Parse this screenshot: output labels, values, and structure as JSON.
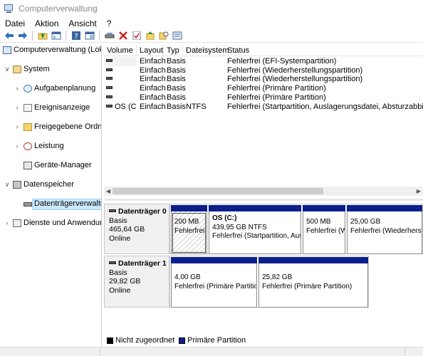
{
  "window": {
    "title": "Computerverwaltung"
  },
  "menu": {
    "items": [
      "Datei",
      "Aktion",
      "Ansicht",
      "?"
    ]
  },
  "toolbar": {
    "buttons": [
      "back-arrow-icon",
      "forward-arrow-icon",
      "up-folder-icon",
      "show-hide-tree-icon",
      "help-icon",
      "properties-icon",
      "connect-drive-icon",
      "delete-icon",
      "check-icon",
      "export-icon",
      "search-icon",
      "rescan-icon"
    ]
  },
  "tree": {
    "root": "Computerverwaltung (Lokal)",
    "system": "System",
    "aufgabenplanung": "Aufgabenplanung",
    "ereignisanzeige": "Ereignisanzeige",
    "freigaben": "Freigegebene Ordner",
    "leistung": "Leistung",
    "geraete": "Geräte-Manager",
    "datenspeicher": "Datenspeicher",
    "datentraeger": "Datenträgerverwaltung",
    "dienste": "Dienste und Anwendungen"
  },
  "volumes": {
    "headers": [
      "Volume",
      "Layout",
      "Typ",
      "Dateisystem",
      "Status"
    ],
    "rows": [
      [
        "",
        "Einfach",
        "Basis",
        "",
        "Fehlerfrei (EFI-Systempartition)"
      ],
      [
        "",
        "Einfach",
        "Basis",
        "",
        "Fehlerfrei (Wiederherstellungspartition)"
      ],
      [
        "",
        "Einfach",
        "Basis",
        "",
        "Fehlerfrei (Wiederherstellungspartition)"
      ],
      [
        "",
        "Einfach",
        "Basis",
        "",
        "Fehlerfrei (Primäre Partition)"
      ],
      [
        "",
        "Einfach",
        "Basis",
        "",
        "Fehlerfrei (Primäre Partition)"
      ],
      [
        "OS (C:)",
        "Einfach",
        "Basis",
        "NTFS",
        "Fehlerfrei (Startpartition, Auslagerungsdatei, Absturzabbild, Primäre P"
      ]
    ]
  },
  "disks": [
    {
      "name": "Datenträger 0",
      "type": "Basis",
      "size": "465,64 GB",
      "state": "Online",
      "partitions": [
        {
          "title": "",
          "size": "200 MB",
          "status": "Fehlerfrei ("
        },
        {
          "title": "OS  (C:)",
          "size": "439,95 GB NTFS",
          "status": "Fehlerfrei (Startpartition, Ausla"
        },
        {
          "title": "",
          "size": "500 MB",
          "status": "Fehlerfrei (W"
        },
        {
          "title": "",
          "size": "25,00 GB",
          "status": "Fehlerfrei (Wiederherste"
        }
      ]
    },
    {
      "name": "Datenträger 1",
      "type": "Basis",
      "size": "29,82 GB",
      "state": "Online",
      "partitions": [
        {
          "title": "",
          "size": "4,00 GB",
          "status": "Fehlerfrei (Primäre Partition)"
        },
        {
          "title": "",
          "size": "25,82 GB",
          "status": "Fehlerfrei (Primäre Partition)"
        }
      ]
    }
  ],
  "legend": {
    "unallocated": "Nicht zugeordnet",
    "primary": "Primäre Partition",
    "unallocated_color": "#000000",
    "primary_color": "#0a1f8c"
  },
  "colors": {
    "selection": "#cce8ff",
    "partition_band": "#0a1f8c"
  }
}
